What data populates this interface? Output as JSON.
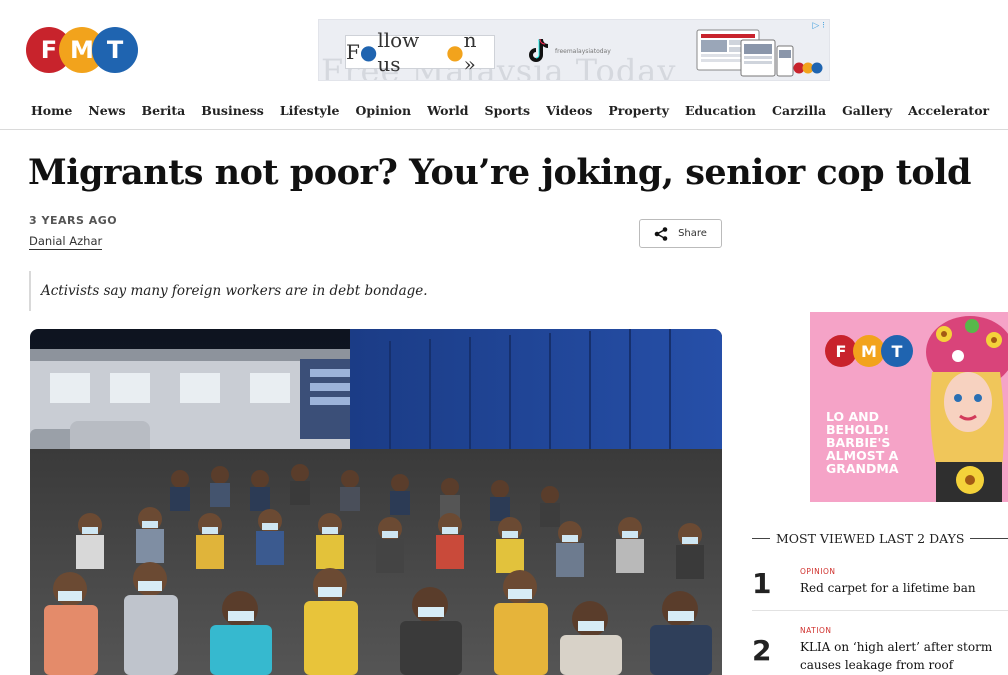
{
  "logo": {
    "letters": [
      "F",
      "M",
      "T"
    ],
    "colors": [
      "#c8232c",
      "#f2a31c",
      "#1f64b0"
    ]
  },
  "banner_ad": {
    "background_text": "Free Malaysia Today",
    "follow_text": "F llow us  n »",
    "follow_prefix": "F",
    "follow_middle": "llow us ",
    "follow_suffix": "n »",
    "handle": "freemalaysiatoday",
    "badge": "▷ ⁝"
  },
  "nav": {
    "items": [
      "Home",
      "News",
      "Berita",
      "Business",
      "Lifestyle",
      "Opinion",
      "World",
      "Sports",
      "Videos",
      "Property",
      "Education",
      "Carzilla",
      "Gallery",
      "Accelerator"
    ]
  },
  "article": {
    "headline": "Migrants not poor? You’re joking, senior cop told",
    "time_ago": "3 YEARS AGO",
    "author": "Danial Azhar",
    "share_label": "Share",
    "standfirst": "Activists say many foreign workers are in debt bondage."
  },
  "side_ad": {
    "text": "LO AND BEHOLD! BARBIE'S ALMOST A GRANDMA",
    "background": "#f5a3c7"
  },
  "most_viewed": {
    "header": "MOST VIEWED LAST 2 DAYS",
    "items": [
      {
        "rank": "1",
        "category": "OPINION",
        "title": "Red carpet for a lifetime ban"
      },
      {
        "rank": "2",
        "category": "NATION",
        "title": "KLIA on ‘high alert’ after storm causes leakage from roof"
      }
    ]
  }
}
